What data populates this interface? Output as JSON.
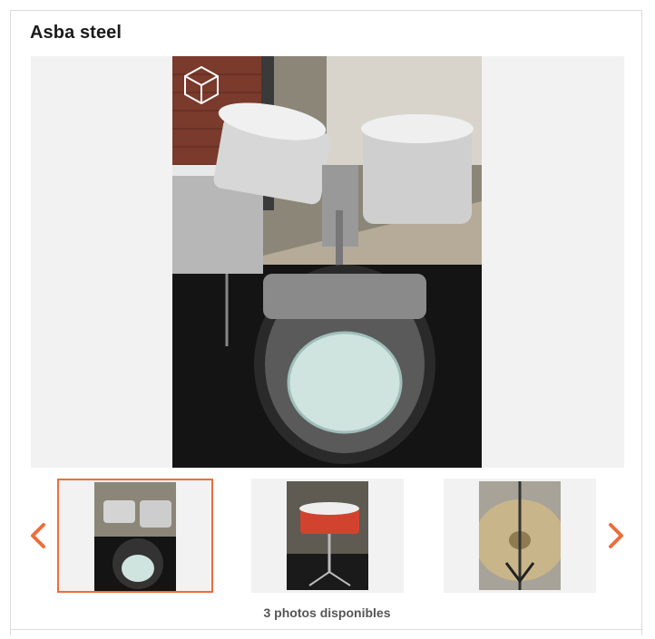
{
  "listing": {
    "title": "Asba steel"
  },
  "gallery": {
    "photo_count_text": "3 photos disponibles",
    "selected_index": 0,
    "thumbnails": [
      {
        "subject": "drum kit"
      },
      {
        "subject": "snare drum on stand"
      },
      {
        "subject": "cymbal"
      }
    ]
  },
  "colors": {
    "accent": "#ec6e3a",
    "frame_bg": "#f2f2f2"
  },
  "icons": {
    "prev": "chevron-left-icon",
    "next": "chevron-right-icon",
    "watermark": "abc-cube-logo"
  }
}
